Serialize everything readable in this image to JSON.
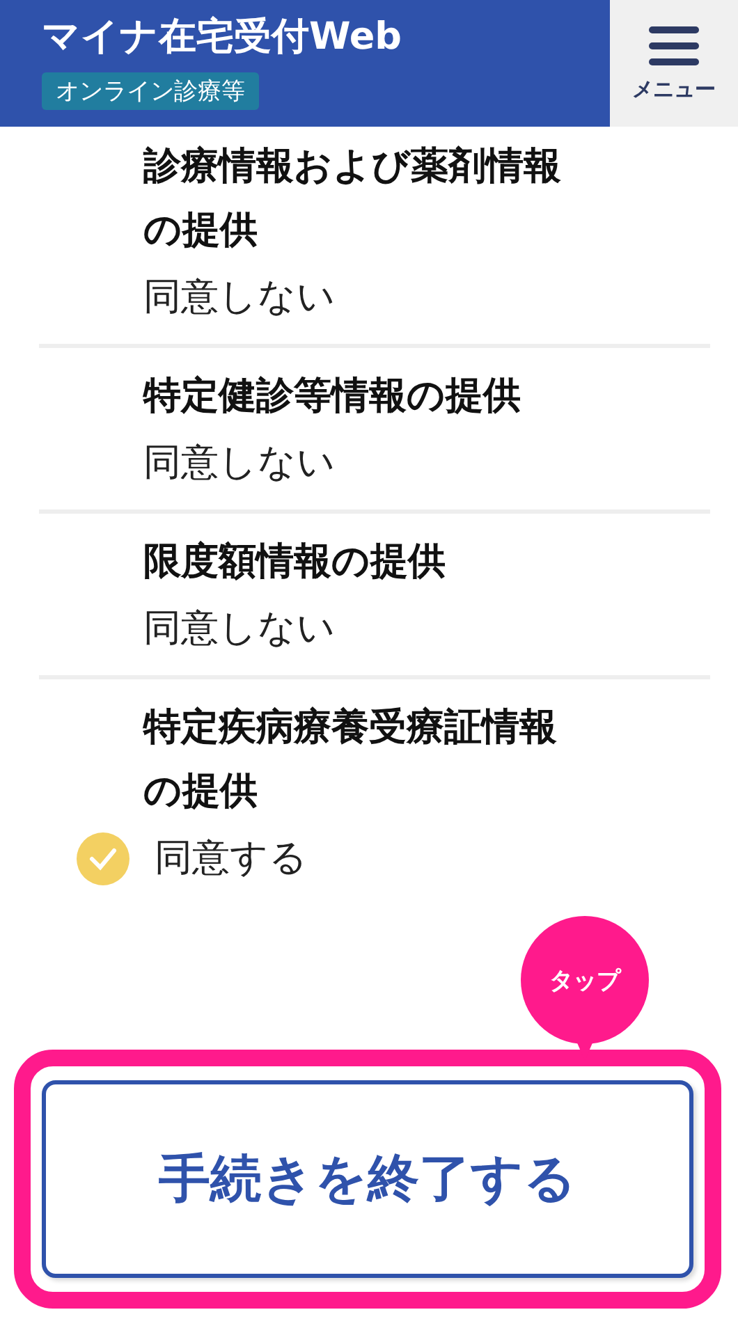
{
  "header": {
    "title": "マイナ在宅受付Web",
    "tag": "オンライン診療等"
  },
  "menu_button": {
    "label": "メニュー"
  },
  "items": [
    {
      "title": "診療情報および薬剤情報の提供",
      "value": "同意しない",
      "agreed": false
    },
    {
      "title": "特定健診等情報の提供",
      "value": "同意しない",
      "agreed": false
    },
    {
      "title": "限度額情報の提供",
      "value": "同意しない",
      "agreed": false
    },
    {
      "title": "特定疾病療養受療証情報の提供",
      "value": "同意する",
      "agreed": true
    }
  ],
  "tooltip": {
    "label": "タップ"
  },
  "finish_button": {
    "label": "手続きを終了する"
  }
}
